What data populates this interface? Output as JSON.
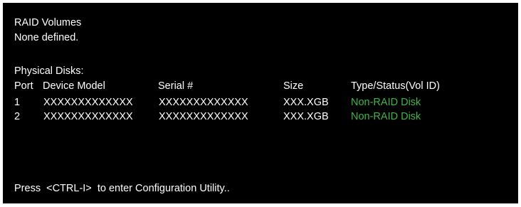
{
  "raid": {
    "heading": "RAID Volumes",
    "status_text": "None defined."
  },
  "physical": {
    "heading": "Physical Disks:",
    "columns": {
      "port": "Port",
      "model": "Device Model",
      "serial": "Serial #",
      "size": "Size",
      "type": "Type/Status(Vol ID)"
    },
    "rows": [
      {
        "port": "1",
        "model": "XXXXXXXXXXXXX",
        "serial": "XXXXXXXXXXXXX",
        "size": "XXX.XGB",
        "type": "Non-RAID Disk"
      },
      {
        "port": "2",
        "model": "XXXXXXXXXXXXX",
        "serial": "XXXXXXXXXXXXX",
        "size": "XXX.XGB",
        "type": "Non-RAID Disk"
      }
    ]
  },
  "footer": {
    "prompt": "Press  <CTRL-I>  to enter Configuration Utility.."
  },
  "colors": {
    "background": "#000000",
    "text": "#ffffff",
    "status": "#3fb54a"
  }
}
